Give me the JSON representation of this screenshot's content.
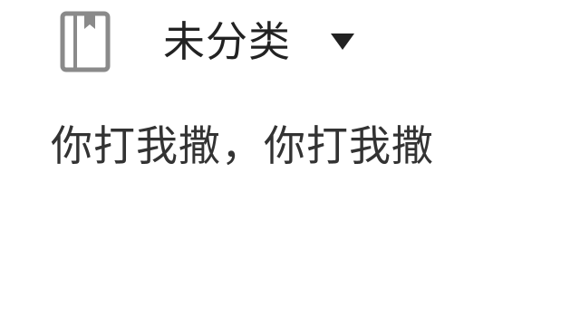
{
  "header": {
    "notebook_icon": "notebook-icon",
    "category_label": "未分类",
    "dropdown_icon": "caret-down-icon"
  },
  "note": {
    "body_text": "你打我撒，你打我撒"
  },
  "colors": {
    "icon_gray": "#8a8a8a",
    "text_dark": "#222222",
    "body_text": "#333333",
    "background": "#ffffff"
  }
}
